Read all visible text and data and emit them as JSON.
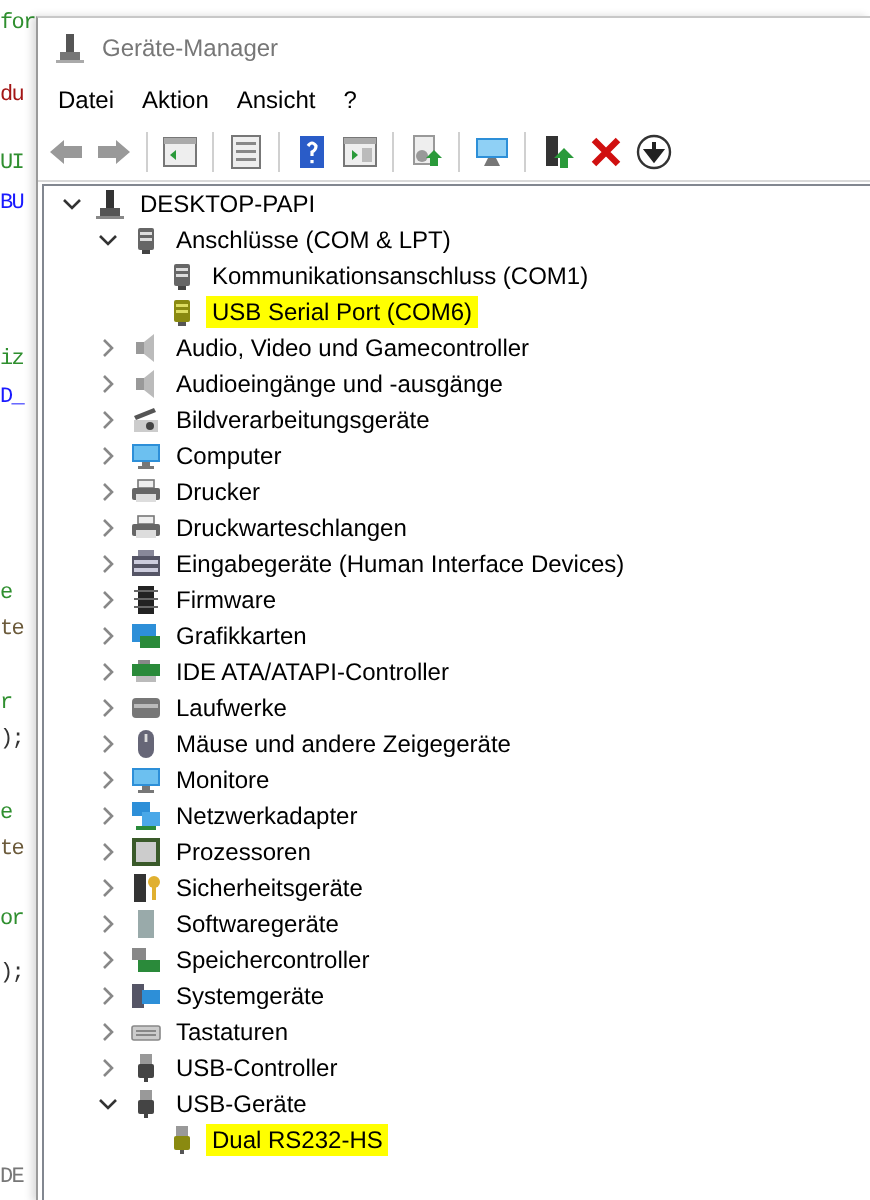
{
  "editor_fragments": [
    {
      "text": "for",
      "color": "#2f8f2f"
    },
    {
      "text": "du",
      "color": "#a31515"
    },
    {
      "text": "UI",
      "color": "#2f8f2f"
    },
    {
      "text": "BU",
      "color": "#1a1aff"
    },
    {
      "text": "iz",
      "color": "#2f8f2f"
    },
    {
      "text": "D_",
      "color": "#1a1aff"
    },
    {
      "text": "e",
      "color": "#2f8f2f"
    },
    {
      "text": "te",
      "color": "#6b5a3a"
    },
    {
      "text": "r",
      "color": "#2f8f2f"
    },
    {
      "text": ");",
      "color": "#333333"
    },
    {
      "text": "e",
      "color": "#2f8f2f"
    },
    {
      "text": "te",
      "color": "#6b5a3a"
    },
    {
      "text": "or",
      "color": "#2f8f2f"
    },
    {
      "text": ");",
      "color": "#333333"
    },
    {
      "text": "DE",
      "color": "#777777"
    }
  ],
  "window": {
    "title": "Geräte-Manager"
  },
  "menu": [
    "Datei",
    "Aktion",
    "Ansicht",
    "?"
  ],
  "tree": [
    {
      "label": "DESKTOP-PAPI",
      "kind": "computer",
      "expanded": true,
      "highlighted": false,
      "children": [
        {
          "label": "Anschlüsse (COM & LPT)",
          "kind": "port",
          "expanded": true,
          "highlighted": false,
          "children": [
            {
              "label": "Kommunikationsanschluss (COM1)",
              "kind": "port",
              "highlighted": false
            },
            {
              "label": "USB Serial Port (COM6)",
              "kind": "port-yellow",
              "highlighted": true
            }
          ]
        },
        {
          "label": "Audio, Video und Gamecontroller",
          "kind": "speaker",
          "expanded": false,
          "highlighted": false
        },
        {
          "label": "Audioeingänge und -ausgänge",
          "kind": "speaker",
          "expanded": false,
          "highlighted": false
        },
        {
          "label": "Bildverarbeitungsgeräte",
          "kind": "camera",
          "expanded": false,
          "highlighted": false
        },
        {
          "label": "Computer",
          "kind": "monitor",
          "expanded": false,
          "highlighted": false
        },
        {
          "label": "Drucker",
          "kind": "printer",
          "expanded": false,
          "highlighted": false
        },
        {
          "label": "Druckwarteschlangen",
          "kind": "printer",
          "expanded": false,
          "highlighted": false
        },
        {
          "label": "Eingabegeräte (Human Interface Devices)",
          "kind": "hid",
          "expanded": false,
          "highlighted": false
        },
        {
          "label": "Firmware",
          "kind": "chip",
          "expanded": false,
          "highlighted": false
        },
        {
          "label": "Grafikkarten",
          "kind": "graphics",
          "expanded": false,
          "highlighted": false
        },
        {
          "label": "IDE ATA/ATAPI-Controller",
          "kind": "card",
          "expanded": false,
          "highlighted": false
        },
        {
          "label": "Laufwerke",
          "kind": "drive",
          "expanded": false,
          "highlighted": false
        },
        {
          "label": "Mäuse und andere Zeigegeräte",
          "kind": "mouse",
          "expanded": false,
          "highlighted": false
        },
        {
          "label": "Monitore",
          "kind": "monitor",
          "expanded": false,
          "highlighted": false
        },
        {
          "label": "Netzwerkadapter",
          "kind": "network",
          "expanded": false,
          "highlighted": false
        },
        {
          "label": "Prozessoren",
          "kind": "processor",
          "expanded": false,
          "highlighted": false
        },
        {
          "label": "Sicherheitsgeräte",
          "kind": "security",
          "expanded": false,
          "highlighted": false
        },
        {
          "label": "Softwaregeräte",
          "kind": "software",
          "expanded": false,
          "highlighted": false
        },
        {
          "label": "Speichercontroller",
          "kind": "storage",
          "expanded": false,
          "highlighted": false
        },
        {
          "label": "Systemgeräte",
          "kind": "system",
          "expanded": false,
          "highlighted": false
        },
        {
          "label": "Tastaturen",
          "kind": "keyboard",
          "expanded": false,
          "highlighted": false
        },
        {
          "label": "USB-Controller",
          "kind": "usb",
          "expanded": false,
          "highlighted": false
        },
        {
          "label": "USB-Geräte",
          "kind": "usb",
          "expanded": true,
          "highlighted": false,
          "children": [
            {
              "label": "Dual RS232-HS",
              "kind": "usb-yellow",
              "highlighted": true
            }
          ]
        }
      ]
    }
  ]
}
